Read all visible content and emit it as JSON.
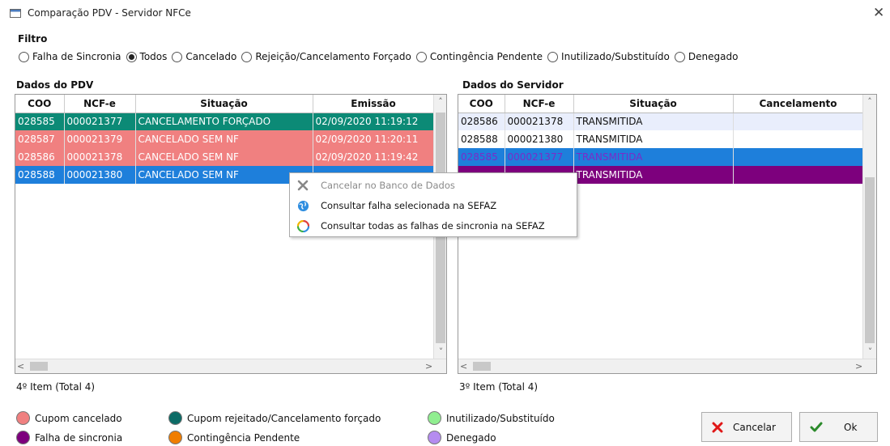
{
  "window": {
    "title": "Comparação PDV - Servidor NFCe",
    "close_glyph": "✕"
  },
  "filter": {
    "label": "Filtro",
    "options": [
      {
        "label": "Falha de Sincronia",
        "selected": false
      },
      {
        "label": "Todos",
        "selected": true
      },
      {
        "label": "Cancelado",
        "selected": false
      },
      {
        "label": "Rejeição/Cancelamento Forçado",
        "selected": false
      },
      {
        "label": "Contingência Pendente",
        "selected": false
      },
      {
        "label": "Inutilizado/Substituído",
        "selected": false
      },
      {
        "label": "Denegado",
        "selected": false
      }
    ]
  },
  "pdv": {
    "label": "Dados do PDV",
    "columns": [
      "COO",
      "NCF-e",
      "Situação",
      "Emissão"
    ],
    "rows": [
      {
        "coo": "028585",
        "ncfe": "000021377",
        "situacao": "CANCELAMENTO FORÇADO",
        "emissao": "02/09/2020 11:19:12",
        "status": "green"
      },
      {
        "coo": "028587",
        "ncfe": "000021379",
        "situacao": "CANCELADO SEM NF",
        "emissao": "02/09/2020 11:20:11",
        "status": "red"
      },
      {
        "coo": "028586",
        "ncfe": "000021378",
        "situacao": "CANCELADO SEM NF",
        "emissao": "02/09/2020 11:19:42",
        "status": "red"
      },
      {
        "coo": "028588",
        "ncfe": "000021380",
        "situacao": "CANCELADO SEM NF",
        "emissao": "",
        "status": "blue"
      }
    ],
    "status_text": "4º Item (Total 4)"
  },
  "server": {
    "label": "Dados do Servidor",
    "columns": [
      "COO",
      "NCF-e",
      "Situação",
      "Cancelamento"
    ],
    "rows": [
      {
        "coo": "028586",
        "ncfe": "000021378",
        "situacao": "TRANSMITIDA",
        "cancelamento": "",
        "status": "light"
      },
      {
        "coo": "028588",
        "ncfe": "000021380",
        "situacao": "TRANSMITIDA",
        "cancelamento": "",
        "status": "white"
      },
      {
        "coo": "028585",
        "ncfe": "000021377",
        "situacao": "TRANSMITIDA",
        "cancelamento": "",
        "status": "blue-sel"
      },
      {
        "coo": "",
        "ncfe": "",
        "situacao": "TRANSMITIDA",
        "cancelamento": "",
        "status": "purple"
      }
    ],
    "status_text": "3º Item (Total 4)"
  },
  "context_menu": {
    "items": [
      {
        "label": "Cancelar no Banco de Dados",
        "icon": "x-icon",
        "disabled": true
      },
      {
        "label": "Consultar falha selecionada na SEFAZ",
        "icon": "globe-icon",
        "disabled": false
      },
      {
        "label": "Consultar todas as falhas de sincronia na SEFAZ",
        "icon": "refresh-icon",
        "disabled": false
      }
    ]
  },
  "legend": [
    {
      "label": "Cupom cancelado",
      "color": "#f08080"
    },
    {
      "label": "Falha de sincronia",
      "color": "#7d007d"
    },
    {
      "label": "Cupom rejeitado/Cancelamento forçado",
      "color": "#0c6b66"
    },
    {
      "label": "Contingência Pendente",
      "color": "#f07d00"
    },
    {
      "label": "Inutilizado/Substituído",
      "color": "#90ee90"
    },
    {
      "label": "Denegado",
      "color": "#b58cf0"
    }
  ],
  "buttons": {
    "cancel": "Cancelar",
    "ok": "Ok"
  },
  "colors": {
    "green": "#0c8a76",
    "red": "#f08080",
    "blue": "#1e7fdb",
    "purple": "#7d007d",
    "selection_text": "#7a2cc8"
  }
}
